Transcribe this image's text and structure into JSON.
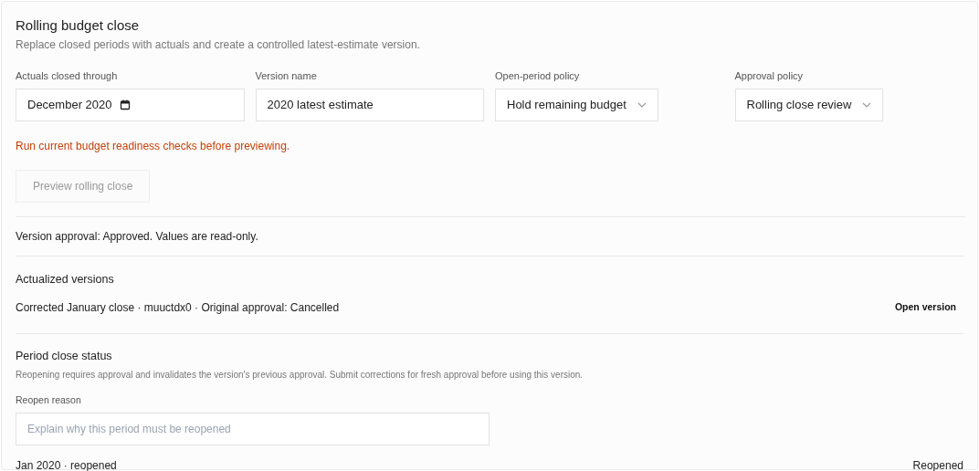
{
  "title": "Rolling budget close",
  "subtitle": "Replace closed periods with actuals and create a controlled latest-estimate version.",
  "fields": [
    {
      "kind": "date",
      "label": "Actuals closed through",
      "value": "December 2020"
    },
    {
      "kind": "text",
      "label": "Version name",
      "value": "2020 latest estimate"
    },
    {
      "kind": "select",
      "label": "Open-period policy",
      "value": "Hold remaining budget"
    },
    {
      "kind": "select",
      "label": "Approval policy",
      "value": "Rolling close review"
    }
  ],
  "warning": "Run current budget readiness checks before previewing.",
  "preview_button": {
    "label": "Preview rolling close",
    "disabled": true
  },
  "approval_status": "Version approval: Approved. Values are read-only.",
  "actualized_versions": {
    "heading": "Actualized versions",
    "rows": [
      {
        "text": "Corrected January close · muuctdx0 · Original approval: Cancelled",
        "action": "Open version"
      }
    ]
  },
  "period_close": {
    "heading": "Period close status",
    "note": "Reopening requires approval and invalidates the version's previous approval. Submit corrections for fresh approval before using this version.",
    "reason_label": "Reopen reason",
    "reason_placeholder": "Explain why this period must be reopened",
    "rows": [
      {
        "period": "Jan 2020 · reopened",
        "status": "Reopened"
      }
    ]
  }
}
